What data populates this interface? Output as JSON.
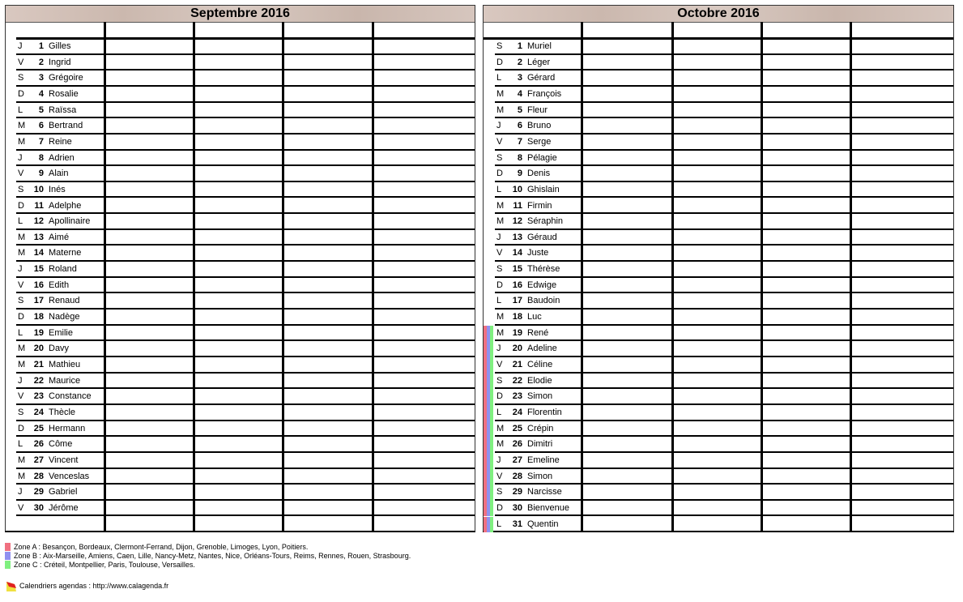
{
  "months": [
    {
      "title": "Septembre 2016",
      "days": [
        [
          "J",
          "1",
          "Gilles"
        ],
        [
          "V",
          "2",
          "Ingrid"
        ],
        [
          "S",
          "3",
          "Grégoire"
        ],
        [
          "D",
          "4",
          "Rosalie"
        ],
        [
          "L",
          "5",
          "Raïssa"
        ],
        [
          "M",
          "6",
          "Bertrand"
        ],
        [
          "M",
          "7",
          "Reine"
        ],
        [
          "J",
          "8",
          "Adrien"
        ],
        [
          "V",
          "9",
          "Alain"
        ],
        [
          "S",
          "10",
          "Inés"
        ],
        [
          "D",
          "11",
          "Adelphe"
        ],
        [
          "L",
          "12",
          "Apollinaire"
        ],
        [
          "M",
          "13",
          "Aimé"
        ],
        [
          "M",
          "14",
          "Materne"
        ],
        [
          "J",
          "15",
          "Roland"
        ],
        [
          "V",
          "16",
          "Edith"
        ],
        [
          "S",
          "17",
          "Renaud"
        ],
        [
          "D",
          "18",
          "Nadège"
        ],
        [
          "L",
          "19",
          "Emilie"
        ],
        [
          "M",
          "20",
          "Davy"
        ],
        [
          "M",
          "21",
          "Mathieu"
        ],
        [
          "J",
          "22",
          "Maurice"
        ],
        [
          "V",
          "23",
          "Constance"
        ],
        [
          "S",
          "24",
          "Thècle"
        ],
        [
          "D",
          "25",
          "Hermann"
        ],
        [
          "L",
          "26",
          "Côme"
        ],
        [
          "M",
          "27",
          "Vincent"
        ],
        [
          "M",
          "28",
          "Venceslas"
        ],
        [
          "J",
          "29",
          "Gabriel"
        ],
        [
          "V",
          "30",
          "Jérôme"
        ]
      ],
      "holiday_days": []
    },
    {
      "title": "Octobre 2016",
      "days": [
        [
          "S",
          "1",
          "Muriel"
        ],
        [
          "D",
          "2",
          "Léger"
        ],
        [
          "L",
          "3",
          "Gérard"
        ],
        [
          "M",
          "4",
          "François"
        ],
        [
          "M",
          "5",
          "Fleur"
        ],
        [
          "J",
          "6",
          "Bruno"
        ],
        [
          "V",
          "7",
          "Serge"
        ],
        [
          "S",
          "8",
          "Pélagie"
        ],
        [
          "D",
          "9",
          "Denis"
        ],
        [
          "L",
          "10",
          "Ghislain"
        ],
        [
          "M",
          "11",
          "Firmin"
        ],
        [
          "M",
          "12",
          "Séraphin"
        ],
        [
          "J",
          "13",
          "Géraud"
        ],
        [
          "V",
          "14",
          "Juste"
        ],
        [
          "S",
          "15",
          "Thérèse"
        ],
        [
          "D",
          "16",
          "Edwige"
        ],
        [
          "L",
          "17",
          "Baudoin"
        ],
        [
          "M",
          "18",
          "Luc"
        ],
        [
          "M",
          "19",
          "René"
        ],
        [
          "J",
          "20",
          "Adeline"
        ],
        [
          "V",
          "21",
          "Céline"
        ],
        [
          "S",
          "22",
          "Elodie"
        ],
        [
          "D",
          "23",
          "Simon"
        ],
        [
          "L",
          "24",
          "Florentin"
        ],
        [
          "M",
          "25",
          "Crépin"
        ],
        [
          "M",
          "26",
          "Dimitri"
        ],
        [
          "J",
          "27",
          "Emeline"
        ],
        [
          "V",
          "28",
          "Simon"
        ],
        [
          "S",
          "29",
          "Narcisse"
        ],
        [
          "D",
          "30",
          "Bienvenue"
        ],
        [
          "L",
          "31",
          "Quentin"
        ]
      ],
      "holiday_days": [
        "19",
        "20",
        "21",
        "22",
        "23",
        "24",
        "25",
        "26",
        "27",
        "28",
        "29",
        "30",
        "31"
      ]
    }
  ],
  "zone_colors": {
    "A": "#f07080",
    "B": "#9090f0",
    "C": "#80f080"
  },
  "legend": {
    "zone_a": "Zone A : Besançon, Bordeaux, Clermont-Ferrand, Dijon, Grenoble, Limoges, Lyon, Poitiers.",
    "zone_b": "Zone B : Aix-Marseille, Amiens, Caen, Lille, Nancy-Metz, Nantes, Nice, Orléans-Tours, Reims, Rennes, Rouen, Strasbourg.",
    "zone_c": "Zone C : Créteil, Montpellier, Paris, Toulouse, Versailles.",
    "credit": "Calendriers agendas : http://www.calagenda.fr"
  }
}
